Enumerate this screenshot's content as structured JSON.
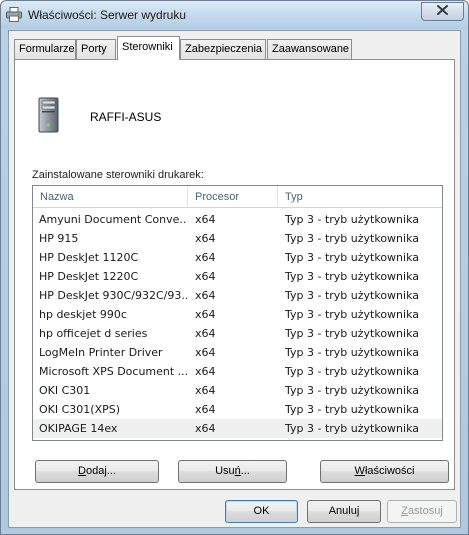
{
  "window": {
    "title": "Właściwości: Serwer wydruku"
  },
  "tabs": [
    {
      "label": "Formularze",
      "active": false
    },
    {
      "label": "Porty",
      "active": false
    },
    {
      "label": "Sterowniki",
      "active": true
    },
    {
      "label": "Zabezpieczenia",
      "active": false
    },
    {
      "label": "Zaawansowane",
      "active": false
    }
  ],
  "server": {
    "name": "RAFFI-ASUS"
  },
  "drivers": {
    "label": "Zainstalowane sterowniki drukarek:",
    "columns": [
      "Nazwa",
      "Procesor",
      "Typ"
    ],
    "rows": [
      {
        "name": "Amyuni Document Conve...",
        "processor": "x64",
        "type": "Typ 3 - tryb użytkownika"
      },
      {
        "name": "HP 915",
        "processor": "x64",
        "type": "Typ 3 - tryb użytkownika"
      },
      {
        "name": "HP DeskJet 1120C",
        "processor": "x64",
        "type": "Typ 3 - tryb użytkownika"
      },
      {
        "name": "HP DeskJet 1220C",
        "processor": "x64",
        "type": "Typ 3 - tryb użytkownika"
      },
      {
        "name": "HP DeskJet 930C/932C/93...",
        "processor": "x64",
        "type": "Typ 3 - tryb użytkownika"
      },
      {
        "name": "hp deskjet 990c",
        "processor": "x64",
        "type": "Typ 3 - tryb użytkownika"
      },
      {
        "name": "hp officejet d series",
        "processor": "x64",
        "type": "Typ 3 - tryb użytkownika"
      },
      {
        "name": "LogMeIn Printer Driver",
        "processor": "x64",
        "type": "Typ 3 - tryb użytkownika"
      },
      {
        "name": "Microsoft XPS Document ...",
        "processor": "x64",
        "type": "Typ 3 - tryb użytkownika"
      },
      {
        "name": "OKI C301",
        "processor": "x64",
        "type": "Typ 3 - tryb użytkownika"
      },
      {
        "name": "OKI C301(XPS)",
        "processor": "x64",
        "type": "Typ 3 - tryb użytkownika"
      },
      {
        "name": "OKIPAGE 14ex",
        "processor": "x64",
        "type": "Typ 3 - tryb użytkownika",
        "selected": true
      }
    ]
  },
  "actions": {
    "add": {
      "underline": "D",
      "rest": "odaj..."
    },
    "remove": {
      "prefix": "Usu",
      "underline": "ń",
      "rest": "..."
    },
    "properties": {
      "underline": "W",
      "rest": "łaściwości"
    }
  },
  "footer": {
    "ok": "OK",
    "cancel": "Anuluj",
    "apply": {
      "underline": "Z",
      "rest": "astosuj"
    }
  },
  "icons": {
    "title": "printer-icon",
    "close": "close-icon",
    "server": "server-icon"
  }
}
